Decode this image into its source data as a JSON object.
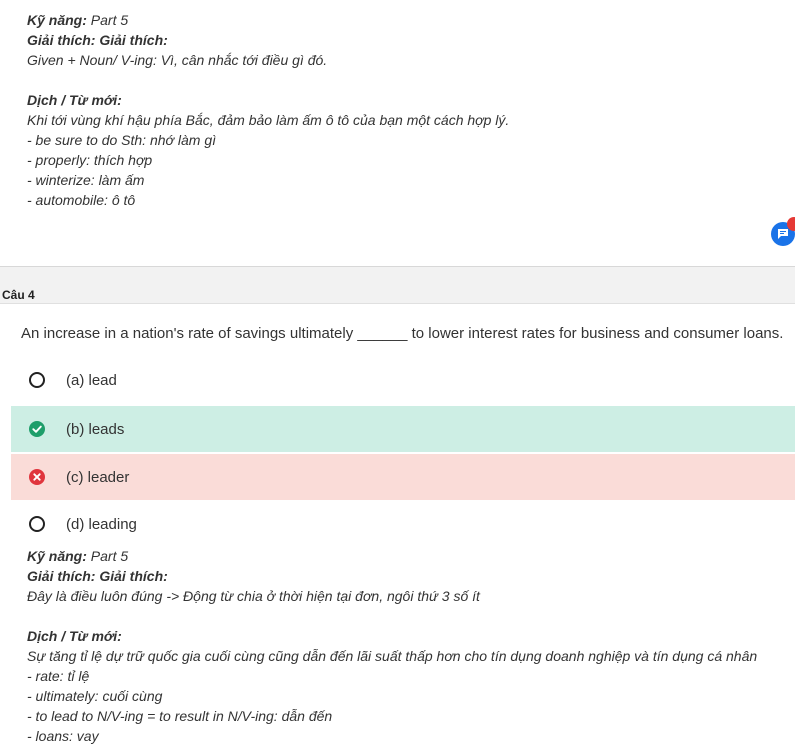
{
  "prev_explanation": {
    "skill_label": "Kỹ năng:",
    "skill_value": "Part 5",
    "explain_label": "Giải thích: Giải thích:",
    "explain_text": "Given + Noun/ V-ing: Vì, cân nhắc tới điều gì đó.",
    "vocab_label": "Dịch / Từ mới:",
    "lines": [
      "Khi tới vùng khí hậu phía Bắc, đảm bảo làm ấm ô tô của bạn một cách hợp lý.",
      "- be sure to do Sth: nhớ làm gì",
      "- properly: thích hợp",
      "- winterize: làm ấm",
      "- automobile: ô tô"
    ]
  },
  "question": {
    "label": "Câu 4",
    "text": "An increase in a nation's rate of savings ultimately ______ to lower interest rates for business and consumer loans.",
    "options": [
      {
        "text": "(a) lead",
        "state": "none"
      },
      {
        "text": "(b) leads",
        "state": "correct"
      },
      {
        "text": "(c) leader",
        "state": "wrong"
      },
      {
        "text": "(d) leading",
        "state": "none"
      }
    ]
  },
  "explanation": {
    "skill_label": "Kỹ năng:",
    "skill_value": "Part 5",
    "explain_label": "Giải thích: Giải thích:",
    "explain_text": "Đây là điều luôn đúng -> Động từ chia ở thời hiện tại đơn, ngôi thứ 3 số ít",
    "vocab_label": "Dịch / Từ mới:",
    "lines": [
      "Sự tăng tỉ lệ dự trữ quốc gia cuối cùng cũng dẫn đến lãi suất thấp hơn cho tín dụng doanh nghiệp và tín dụng cá nhân",
      "- rate: tỉ lệ",
      "- ultimately: cuối cùng",
      "- to lead to N/V-ing = to result in N/V-ing: dẫn đến",
      "- loans: vay"
    ]
  },
  "colors": {
    "correct_bg": "#cdeee4",
    "wrong_bg": "#fadcd8",
    "correct_icon": "#1e9e6a",
    "wrong_icon": "#e0353d",
    "chat_button": "#1a73e8"
  },
  "icons": {
    "correct": "check-circle-icon",
    "wrong": "x-circle-icon",
    "chat": "chat-icon"
  }
}
